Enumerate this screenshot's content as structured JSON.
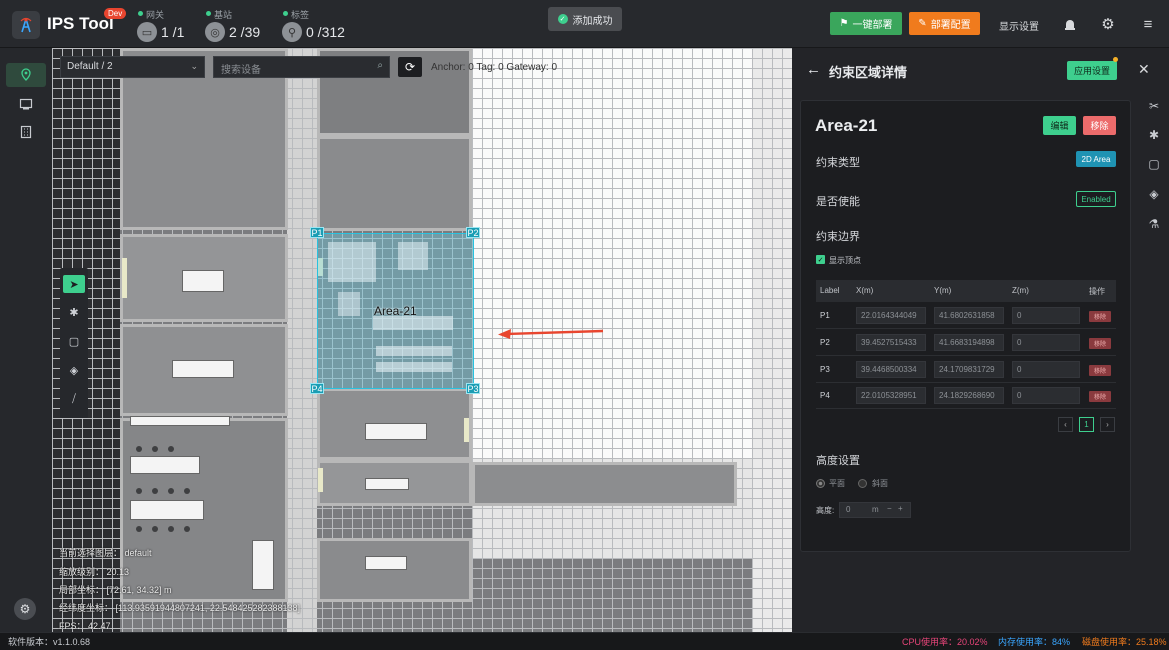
{
  "app": {
    "title": "IPS Tool",
    "badge": "Dev"
  },
  "header": {
    "gateway": {
      "label": "网关",
      "value": "1 /1"
    },
    "station": {
      "label": "基站",
      "value": "2 /39"
    },
    "tag": {
      "label": "标签",
      "value": "0 /312"
    },
    "toast": "添加成功",
    "deploy_btn": "一键部署",
    "config_btn": "部署配置",
    "display_settings": "显示设置"
  },
  "map": {
    "layer_select": "Default / 2",
    "search_placeholder": "搜索设备",
    "counts": "Anchor: 0   Tag: 0   Gateway: 0",
    "area_label": "Area-21",
    "points": [
      "P1",
      "P2",
      "P3",
      "P4"
    ],
    "info": {
      "layer": "当前选择图层：  default",
      "zoom": "缩放级别：  20.13",
      "local": "局部坐标：  [72.61, 34.32]  m",
      "geo": "经纬度坐标：  [113.93591944807241, 22.548425282388138]",
      "fps": "FPS：  42.47"
    }
  },
  "panel": {
    "title": "约束区域详情",
    "apply": "应用设置",
    "area_name": "Area-21",
    "edit": "编辑",
    "remove": "移除",
    "type_label": "约束类型",
    "type_value": "2D Area",
    "enabled_label": "是否使能",
    "enabled_value": "Enabled",
    "boundary_label": "约束边界",
    "show_vertices": "显示顶点",
    "columns": [
      "Label",
      "X(m)",
      "Y(m)",
      "Z(m)",
      "操作"
    ],
    "rows": [
      {
        "label": "P1",
        "x": "22.0164344049",
        "y": "41.6802631858",
        "z": "0",
        "op": "移除"
      },
      {
        "label": "P2",
        "x": "39.4527515433",
        "y": "41.6683194898",
        "z": "0",
        "op": "移除"
      },
      {
        "label": "P3",
        "x": "39.4468500334",
        "y": "24.1709831729",
        "z": "0",
        "op": "移除"
      },
      {
        "label": "P4",
        "x": "22.0105328951",
        "y": "24.1829268690",
        "z": "0",
        "op": "移除"
      }
    ],
    "page": "1",
    "height_label": "高度设置",
    "flat": "平面",
    "slope": "斜面",
    "height_field": "高度:",
    "height_value": "0",
    "height_unit": "m"
  },
  "status": {
    "version": "软件版本：v1.1.0.68",
    "cpu": "CPU使用率：20.02%",
    "mem": "内存使用率：84%",
    "disk": "磁盘使用率：25.18%"
  },
  "colors": {
    "accent": "#3ecf8e",
    "orange": "#f07b1d",
    "area": "#29c2e0",
    "danger": "#ec6b6b"
  }
}
